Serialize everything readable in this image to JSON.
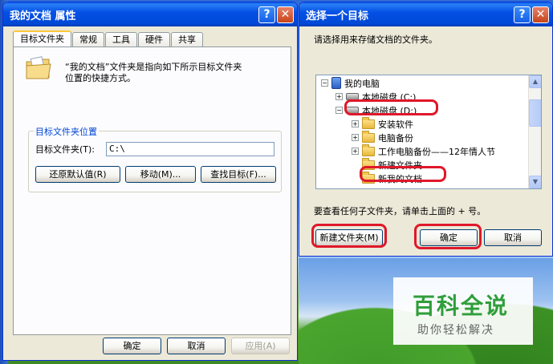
{
  "left_dialog": {
    "title": "我的文档 属性",
    "help_glyph": "?",
    "close_glyph": "✕",
    "tabs": [
      "目标文件夹",
      "常规",
      "工具",
      "硬件",
      "共享"
    ],
    "description_line1": "“我的文档”文件夹是指向如下所示目标文件夹",
    "description_line2": "位置的快捷方式。",
    "group_title": "目标文件夹位置",
    "field_label": "目标文件夹(T):",
    "field_value": "C:\\",
    "buttons": {
      "restore": "还原默认值(R)",
      "move": "移动(M)...",
      "find": "查找目标(F)..."
    },
    "footer": {
      "ok": "确定",
      "cancel": "取消",
      "apply": "应用(A)"
    }
  },
  "right_dialog": {
    "title": "选择一个目标",
    "help_glyph": "?",
    "close_glyph": "✕",
    "prompt": "请选择用来存储文档的文件夹。",
    "tree": [
      {
        "label": "我的电脑",
        "expander": "−",
        "icon": "computer-icon"
      },
      {
        "label": "本地磁盘 (C:)",
        "expander": "+",
        "icon": "drive-icon"
      },
      {
        "label": "本地磁盘 (D:)",
        "expander": "−",
        "icon": "drive-icon"
      },
      {
        "label": "安装软件",
        "expander": "+",
        "icon": "folder-icon"
      },
      {
        "label": "电脑备份",
        "expander": "+",
        "icon": "folder-icon"
      },
      {
        "label": "工作电脑备份——12年情人节",
        "expander": "+",
        "icon": "folder-icon"
      },
      {
        "label": "新建文件夹",
        "expander": "",
        "icon": "folder-icon"
      },
      {
        "label": "新我的文档",
        "expander": "",
        "icon": "folder-icon"
      }
    ],
    "hint": "要查看任何子文件夹，请单击上面的 + 号。",
    "buttons": {
      "new_folder": "新建文件夹(M)",
      "ok": "确定",
      "cancel": "取消"
    }
  },
  "watermark": {
    "main": "百科全说",
    "sub": "助你轻松解决"
  },
  "colors": {
    "highlight_ring": "#e0182a",
    "title_bar": "#0551e6",
    "dialog_bg": "#ece9d8"
  }
}
